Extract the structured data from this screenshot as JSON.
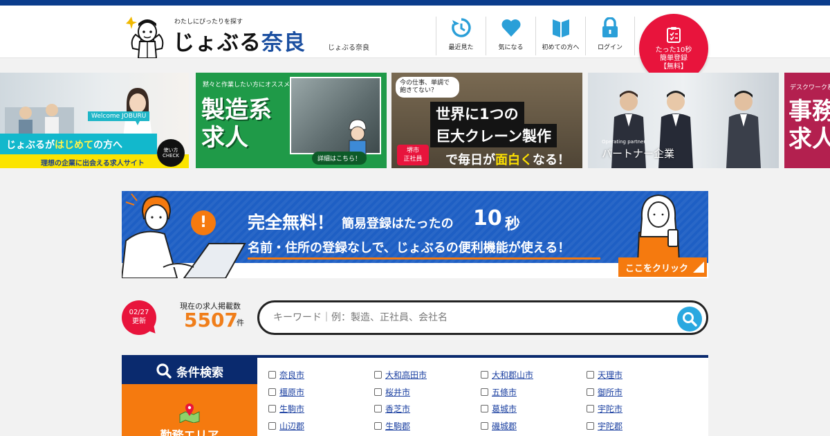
{
  "header": {
    "logo_tagline": "わたしにぴったりを探す",
    "logo_main": "じょぶる",
    "logo_region": "奈良",
    "site_name": "じょぶる奈良",
    "nav": [
      {
        "label": "最近見た",
        "icon": "history-icon"
      },
      {
        "label": "気になる",
        "icon": "heart-icon"
      },
      {
        "label": "初めての方へ",
        "icon": "book-icon"
      },
      {
        "label": "ログイン",
        "icon": "lock-icon"
      }
    ],
    "cta": {
      "line1": "たった10秒",
      "line2": "簡単登録",
      "line3": "【無料】",
      "icon": "clipboard-icon"
    }
  },
  "banners": {
    "b1": {
      "welcome": "Welcome JOBURU",
      "main_pre": "じょぶるが",
      "main_hl": "はじめて",
      "main_post": "の方へ",
      "check": "使い方 CHECK",
      "foot": "理想の企業に出会える求人サイト"
    },
    "b2": {
      "tag": "黙々と作業したい方にオススメ",
      "line1": "製造系",
      "line2": "求人",
      "detail": "詳細はこちら！"
    },
    "b3": {
      "bubble": "今の仕事、単調で飽きてない？",
      "line1": "世界に1つの",
      "line2": "巨大クレーン製作",
      "stamp1": "堺市",
      "stamp2": "正社員",
      "line3_pre": "で毎日が",
      "line3_hl": "面白く",
      "line3_post": "なる！"
    },
    "b4": {
      "small": "Operating partner",
      "caption": "パートナー企業"
    },
    "b5": {
      "tag": "デスクワーク系",
      "line1": "事務",
      "line2": "求人"
    }
  },
  "promo": {
    "title": "完全無料！",
    "sub": "簡易登録はたったの",
    "num": "10",
    "unit": "秒",
    "line2": "名前・住所の登録なしで、じょぶるの便利機能が使える！",
    "click": "ここをクリック"
  },
  "search": {
    "update_date": "02/27",
    "update_label": "更新",
    "count_label": "現在の求人掲載数",
    "count": "5507",
    "count_unit": "件",
    "placeholder": "キーワード｜例：製造、正社員、会社名"
  },
  "conditions": {
    "title": "条件検索",
    "side_label": "勤務エリア",
    "areas": [
      "奈良市",
      "大和高田市",
      "大和郡山市",
      "天理市",
      "橿原市",
      "桜井市",
      "五條市",
      "御所市",
      "生駒市",
      "香芝市",
      "葛城市",
      "宇陀市",
      "山辺郡",
      "生駒郡",
      "磯城郡",
      "宇陀郡"
    ]
  },
  "colors": {
    "brand_navy": "#0a2a6e",
    "accent_orange": "#f57a0f",
    "cta_red": "#e8143c",
    "link_blue": "#1a3fa0"
  }
}
